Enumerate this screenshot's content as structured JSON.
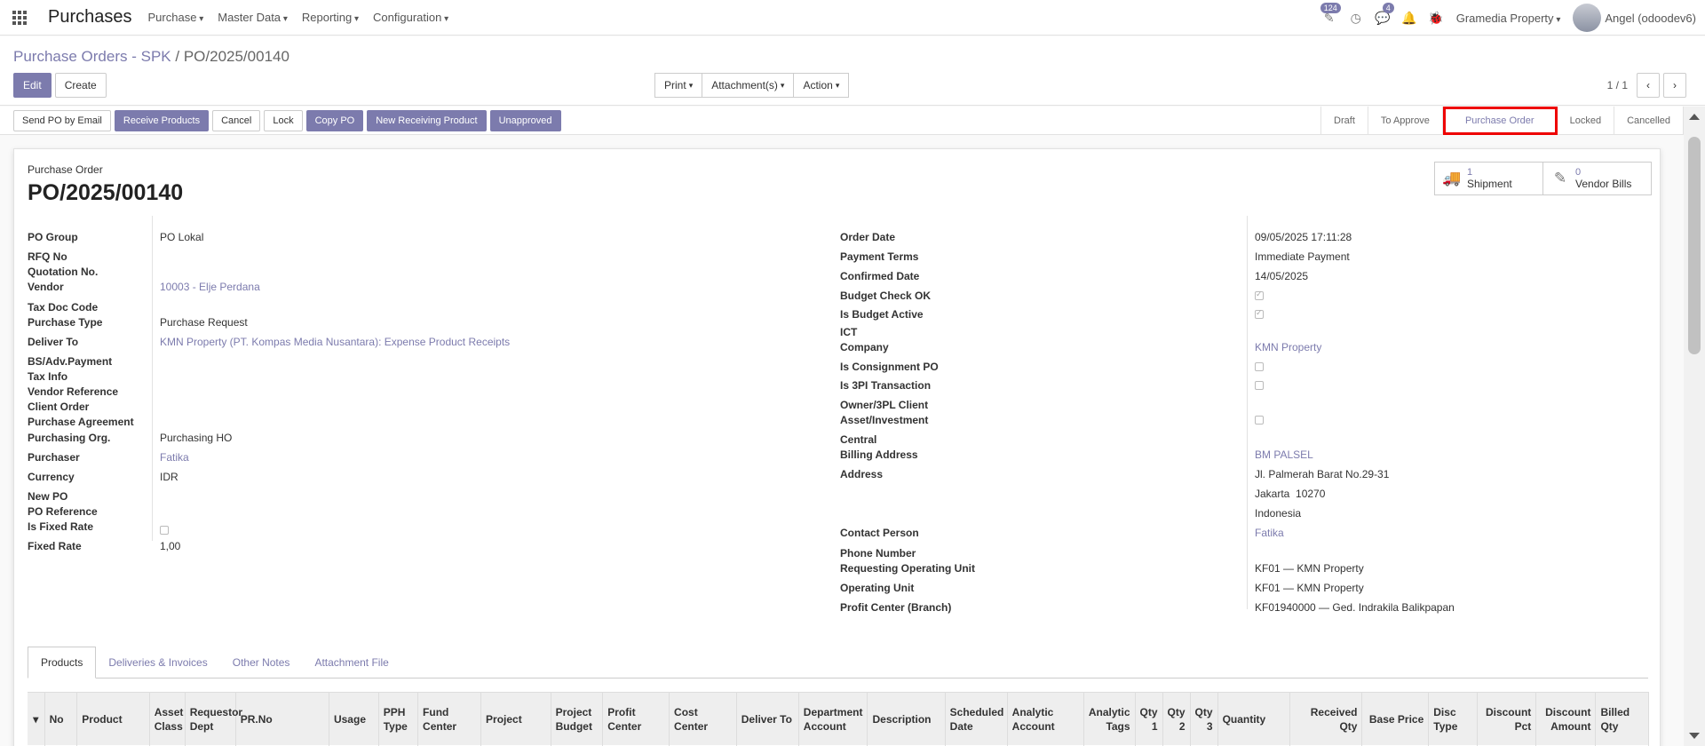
{
  "navbar": {
    "app_name": "Purchases",
    "menus": [
      "Purchase",
      "Master Data",
      "Reporting",
      "Configuration"
    ],
    "activity_badge": "124",
    "messages_badge": "4",
    "company": "Gramedia Property",
    "user": "Angel (odoodev6)"
  },
  "breadcrumb": {
    "parent": "Purchase Orders - SPK",
    "separator": "/",
    "current": "PO/2025/00140"
  },
  "control": {
    "edit": "Edit",
    "create": "Create",
    "print": "Print",
    "attachments": "Attachment(s)",
    "action": "Action",
    "pager": "1 / 1"
  },
  "statusbar": {
    "buttons": [
      "Send PO by Email",
      "Receive Products",
      "Cancel",
      "Lock",
      "Copy PO",
      "New Receiving Product",
      "Unapproved"
    ],
    "stages": [
      "Draft",
      "To Approve",
      "Purchase Order",
      "Locked",
      "Cancelled"
    ],
    "active_stage": "Purchase Order"
  },
  "smart_buttons": {
    "shipment_count": "1",
    "shipment_label": "Shipment",
    "bills_count": "0",
    "bills_label": "Vendor Bills"
  },
  "form": {
    "doc_label": "Purchase Order",
    "doc_name": "PO/2025/00140",
    "left": {
      "po_group": {
        "label": "PO Group",
        "value": "PO Lokal"
      },
      "rfq_no": {
        "label": "RFQ No",
        "value": ""
      },
      "quotation_no": {
        "label": "Quotation No.",
        "value": ""
      },
      "vendor": {
        "label": "Vendor",
        "value": "10003 - Elje Perdana"
      },
      "tax_doc_code": {
        "label": "Tax Doc Code",
        "value": ""
      },
      "purchase_type": {
        "label": "Purchase Type",
        "value": "Purchase Request"
      },
      "deliver_to": {
        "label": "Deliver To",
        "value": "KMN Property (PT. Kompas Media Nusantara): Expense Product Receipts"
      },
      "bs_adv_payment": {
        "label": "BS/Adv.Payment",
        "value": ""
      },
      "tax_info": {
        "label": "Tax Info",
        "value": ""
      },
      "vendor_reference": {
        "label": "Vendor Reference",
        "value": ""
      },
      "client_order": {
        "label": "Client Order",
        "value": ""
      },
      "purchase_agreement": {
        "label": "Purchase Agreement",
        "value": ""
      },
      "purchasing_org": {
        "label": "Purchasing Org.",
        "value": "Purchasing HO"
      },
      "purchaser": {
        "label": "Purchaser",
        "value": "Fatika"
      },
      "currency": {
        "label": "Currency",
        "value": "IDR"
      },
      "new_po": {
        "label": "New PO",
        "value": ""
      },
      "po_reference": {
        "label": "PO Reference",
        "value": ""
      },
      "is_fixed_rate": {
        "label": "Is Fixed Rate",
        "checked": false
      },
      "fixed_rate": {
        "label": "Fixed Rate",
        "value": "1,00"
      }
    },
    "right": {
      "order_date": {
        "label": "Order Date",
        "value": "09/05/2025 17:11:28"
      },
      "payment_terms": {
        "label": "Payment Terms",
        "value": "Immediate Payment"
      },
      "confirmed_date": {
        "label": "Confirmed Date",
        "value": "14/05/2025"
      },
      "budget_check_ok": {
        "label": "Budget Check OK",
        "checked": true
      },
      "is_budget_active": {
        "label": "Is Budget Active",
        "checked": true
      },
      "ict": {
        "label": "ICT",
        "value": ""
      },
      "company": {
        "label": "Company",
        "value": "KMN Property"
      },
      "is_consignment_po": {
        "label": "Is Consignment PO",
        "checked": false
      },
      "is_3pl_transaction": {
        "label": "Is 3PI Transaction",
        "checked": false
      },
      "owner_3pl_client": {
        "label": "Owner/3PL Client",
        "value": ""
      },
      "asset_investment": {
        "label": "Asset/Investment",
        "checked": false
      },
      "central": {
        "label": "Central",
        "value": ""
      },
      "billing_address": {
        "label": "Billing Address",
        "value": "BM PALSEL"
      },
      "address": {
        "label": "Address",
        "line1": "Jl. Palmerah Barat No.29-31",
        "line2": "Jakarta  10270",
        "line3": "Indonesia"
      },
      "contact_person": {
        "label": "Contact Person",
        "value": "Fatika"
      },
      "phone_number": {
        "label": "Phone Number",
        "value": ""
      },
      "requesting_operating_unit": {
        "label": "Requesting Operating Unit",
        "value": "KF01 — KMN Property"
      },
      "operating_unit": {
        "label": "Operating Unit",
        "value": "KF01 — KMN Property"
      },
      "profit_center": {
        "label": "Profit Center (Branch)",
        "value": "KF01940000 — Ged. Indrakila Balikpapan"
      }
    }
  },
  "tabs": [
    "Products",
    "Deliveries & Invoices",
    "Other Notes",
    "Attachment File"
  ],
  "products_table": {
    "columns": [
      "No",
      "Product",
      "Asset Class",
      "Requestor Dept",
      "PR.No",
      "Usage",
      "PPH Type",
      "Fund Center",
      "Project",
      "Project Budget",
      "Profit Center",
      "Cost Center",
      "Deliver To",
      "Department Account",
      "Description",
      "Scheduled Date",
      "Analytic Account",
      "Analytic Tags",
      "Qty 1",
      "Qty 2",
      "Qty 3",
      "Quantity",
      "Received Qty",
      "Base Price",
      "Disc Type",
      "Discount Pct",
      "Discount Amount",
      "Billed Qty"
    ]
  }
}
